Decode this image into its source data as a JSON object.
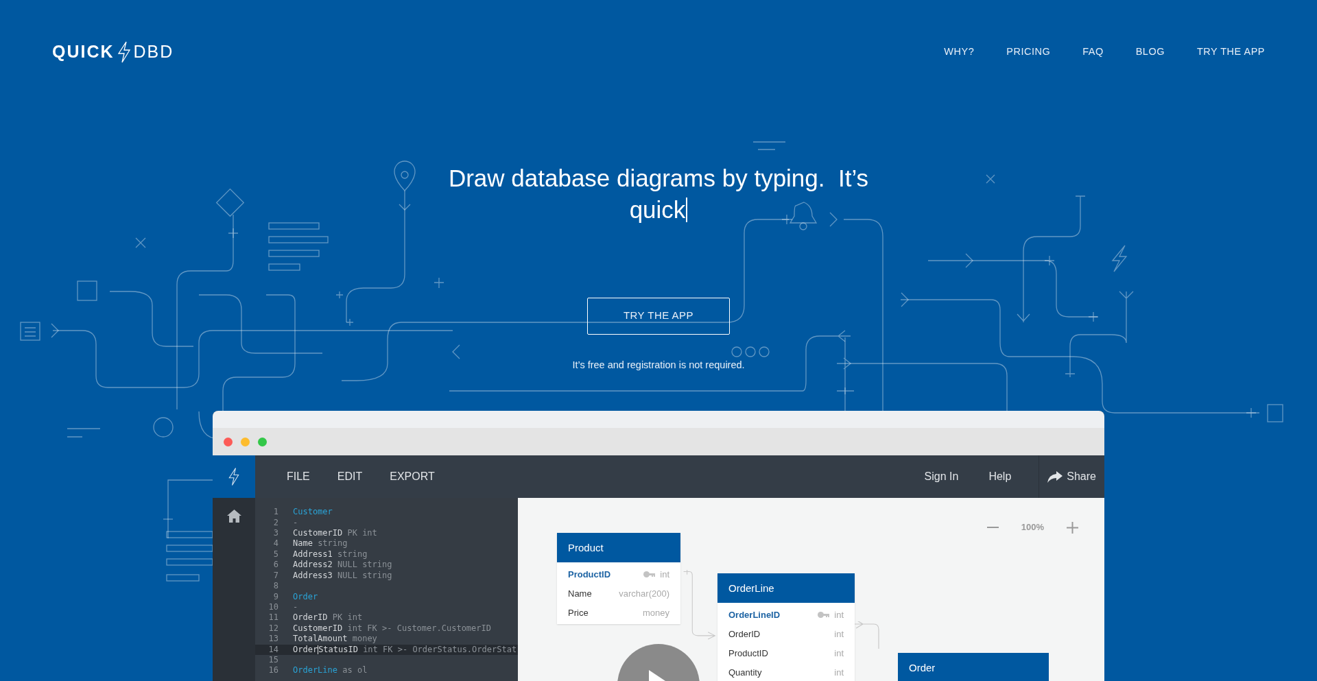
{
  "logo": {
    "left": "QUICK",
    "right": "DBD"
  },
  "nav": [
    "WHY?",
    "PRICING",
    "FAQ",
    "BLOG",
    "TRY THE APP"
  ],
  "hero": {
    "headline_lines": [
      "Draw database diagrams by typing.  It’s",
      "quick"
    ],
    "button": "TRY THE APP",
    "note": "It’s free and registration is not required."
  },
  "app": {
    "menu": [
      "FILE",
      "EDIT",
      "EXPORT"
    ],
    "right_menu": [
      "Sign In",
      "Help"
    ],
    "share": "Share",
    "editor": {
      "lines": [
        {
          "number": "1",
          "selected": false,
          "tokens": [
            {
              "text": "Customer",
              "kind": "table"
            }
          ]
        },
        {
          "number": "2",
          "selected": false,
          "tokens": [
            {
              "text": "-",
              "kind": "type"
            }
          ]
        },
        {
          "number": "3",
          "selected": false,
          "tokens": [
            {
              "text": "CustomerID",
              "kind": "name"
            },
            {
              "text": " PK int",
              "kind": "type"
            }
          ]
        },
        {
          "number": "4",
          "selected": false,
          "tokens": [
            {
              "text": "Name",
              "kind": "name"
            },
            {
              "text": " string",
              "kind": "type"
            }
          ]
        },
        {
          "number": "5",
          "selected": false,
          "tokens": [
            {
              "text": "Address1",
              "kind": "name"
            },
            {
              "text": " string",
              "kind": "type"
            }
          ]
        },
        {
          "number": "6",
          "selected": false,
          "tokens": [
            {
              "text": "Address2",
              "kind": "name"
            },
            {
              "text": " NULL string",
              "kind": "type"
            }
          ]
        },
        {
          "number": "7",
          "selected": false,
          "tokens": [
            {
              "text": "Address3",
              "kind": "name"
            },
            {
              "text": " NULL string",
              "kind": "type"
            }
          ]
        },
        {
          "number": "8",
          "selected": false
        },
        {
          "number": "9",
          "selected": false,
          "tokens": [
            {
              "text": "Order",
              "kind": "table"
            }
          ]
        },
        {
          "number": "10",
          "selected": false,
          "tokens": [
            {
              "text": "-",
              "kind": "type"
            }
          ]
        },
        {
          "number": "11",
          "selected": false,
          "tokens": [
            {
              "text": "OrderID",
              "kind": "name"
            },
            {
              "text": " PK int",
              "kind": "type"
            }
          ]
        },
        {
          "number": "12",
          "selected": false,
          "tokens": [
            {
              "text": "CustomerID",
              "kind": "name"
            },
            {
              "text": " int FK >- Customer.CustomerID",
              "kind": "type"
            }
          ]
        },
        {
          "number": "13",
          "selected": false,
          "tokens": [
            {
              "text": "TotalAmount",
              "kind": "name"
            },
            {
              "text": " money",
              "kind": "type"
            }
          ]
        },
        {
          "number": "14",
          "selected": true,
          "tokens": [
            {
              "text": "Order",
              "kind": "name"
            },
            {
              "kind": "cursor"
            },
            {
              "text": "StatusID",
              "kind": "name"
            },
            {
              "text": " int FK >- OrderStatus.OrderStat",
              "kind": "type"
            }
          ]
        },
        {
          "number": "15",
          "selected": false
        },
        {
          "number": "16",
          "selected": false,
          "tokens": [
            {
              "text": "OrderLine",
              "kind": "table"
            },
            {
              "text": " as ol",
              "kind": "type"
            }
          ]
        }
      ]
    },
    "zoom": "100%",
    "tables": [
      {
        "name": "Product",
        "fields": [
          {
            "name": "ProductID",
            "type": "int",
            "primary": true
          },
          {
            "name": "Name",
            "type": "varchar(200)",
            "primary": false
          },
          {
            "name": "Price",
            "type": "money",
            "primary": false
          }
        ]
      },
      {
        "name": "OrderLine",
        "fields": [
          {
            "name": "OrderLineID",
            "type": "int",
            "primary": true
          },
          {
            "name": "OrderID",
            "type": "int",
            "primary": false
          },
          {
            "name": "ProductID",
            "type": "int",
            "primary": false
          },
          {
            "name": "Quantity",
            "type": "int",
            "primary": false
          }
        ]
      },
      {
        "name": "Order"
      }
    ]
  }
}
